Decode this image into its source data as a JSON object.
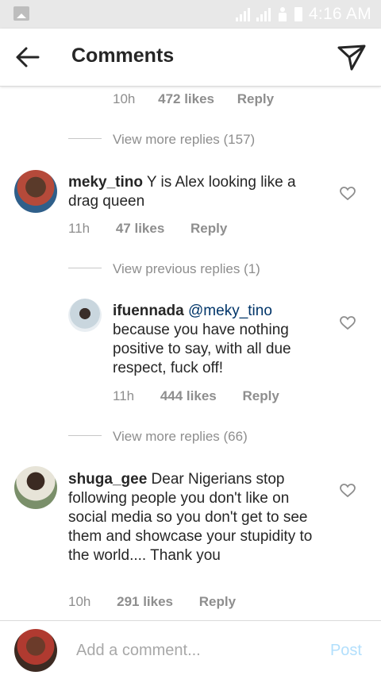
{
  "status_bar": {
    "time": "4:16 AM"
  },
  "header": {
    "title": "Comments"
  },
  "top_reply_meta": {
    "time": "10h",
    "likes": "472 likes",
    "reply": "Reply"
  },
  "view_more_1": "View more replies (157)",
  "comment_1": {
    "username": "meky_tino",
    "text": "Y is Alex looking like a drag queen",
    "time": "11h",
    "likes": "47 likes",
    "reply": "Reply"
  },
  "view_previous": "View previous replies (1)",
  "reply_1": {
    "username": "ifuennada",
    "mention": "@meky_tino",
    "text": "because you have  nothing positive to say,  with all due respect,  fuck off!",
    "time": "11h",
    "likes": "444 likes",
    "reply": "Reply"
  },
  "view_more_2": "View more replies (66)",
  "comment_2": {
    "username": "shuga_gee",
    "text": "Dear Nigerians stop following people you don't like on social media so you don't get to  see them and showcase your stupidity to the world.... Thank you",
    "time": "10h",
    "likes": "291 likes",
    "reply": "Reply"
  },
  "footer": {
    "placeholder": "Add a comment...",
    "post": "Post"
  },
  "colors": {
    "accent_mention": "#003569",
    "post_disabled": "#b2dffc",
    "meta_gray": "#8e8e8e"
  },
  "icons": [
    "image-icon",
    "signal-icon",
    "person-icon",
    "battery-icon",
    "back-arrow-icon",
    "send-icon",
    "heart-icon"
  ]
}
